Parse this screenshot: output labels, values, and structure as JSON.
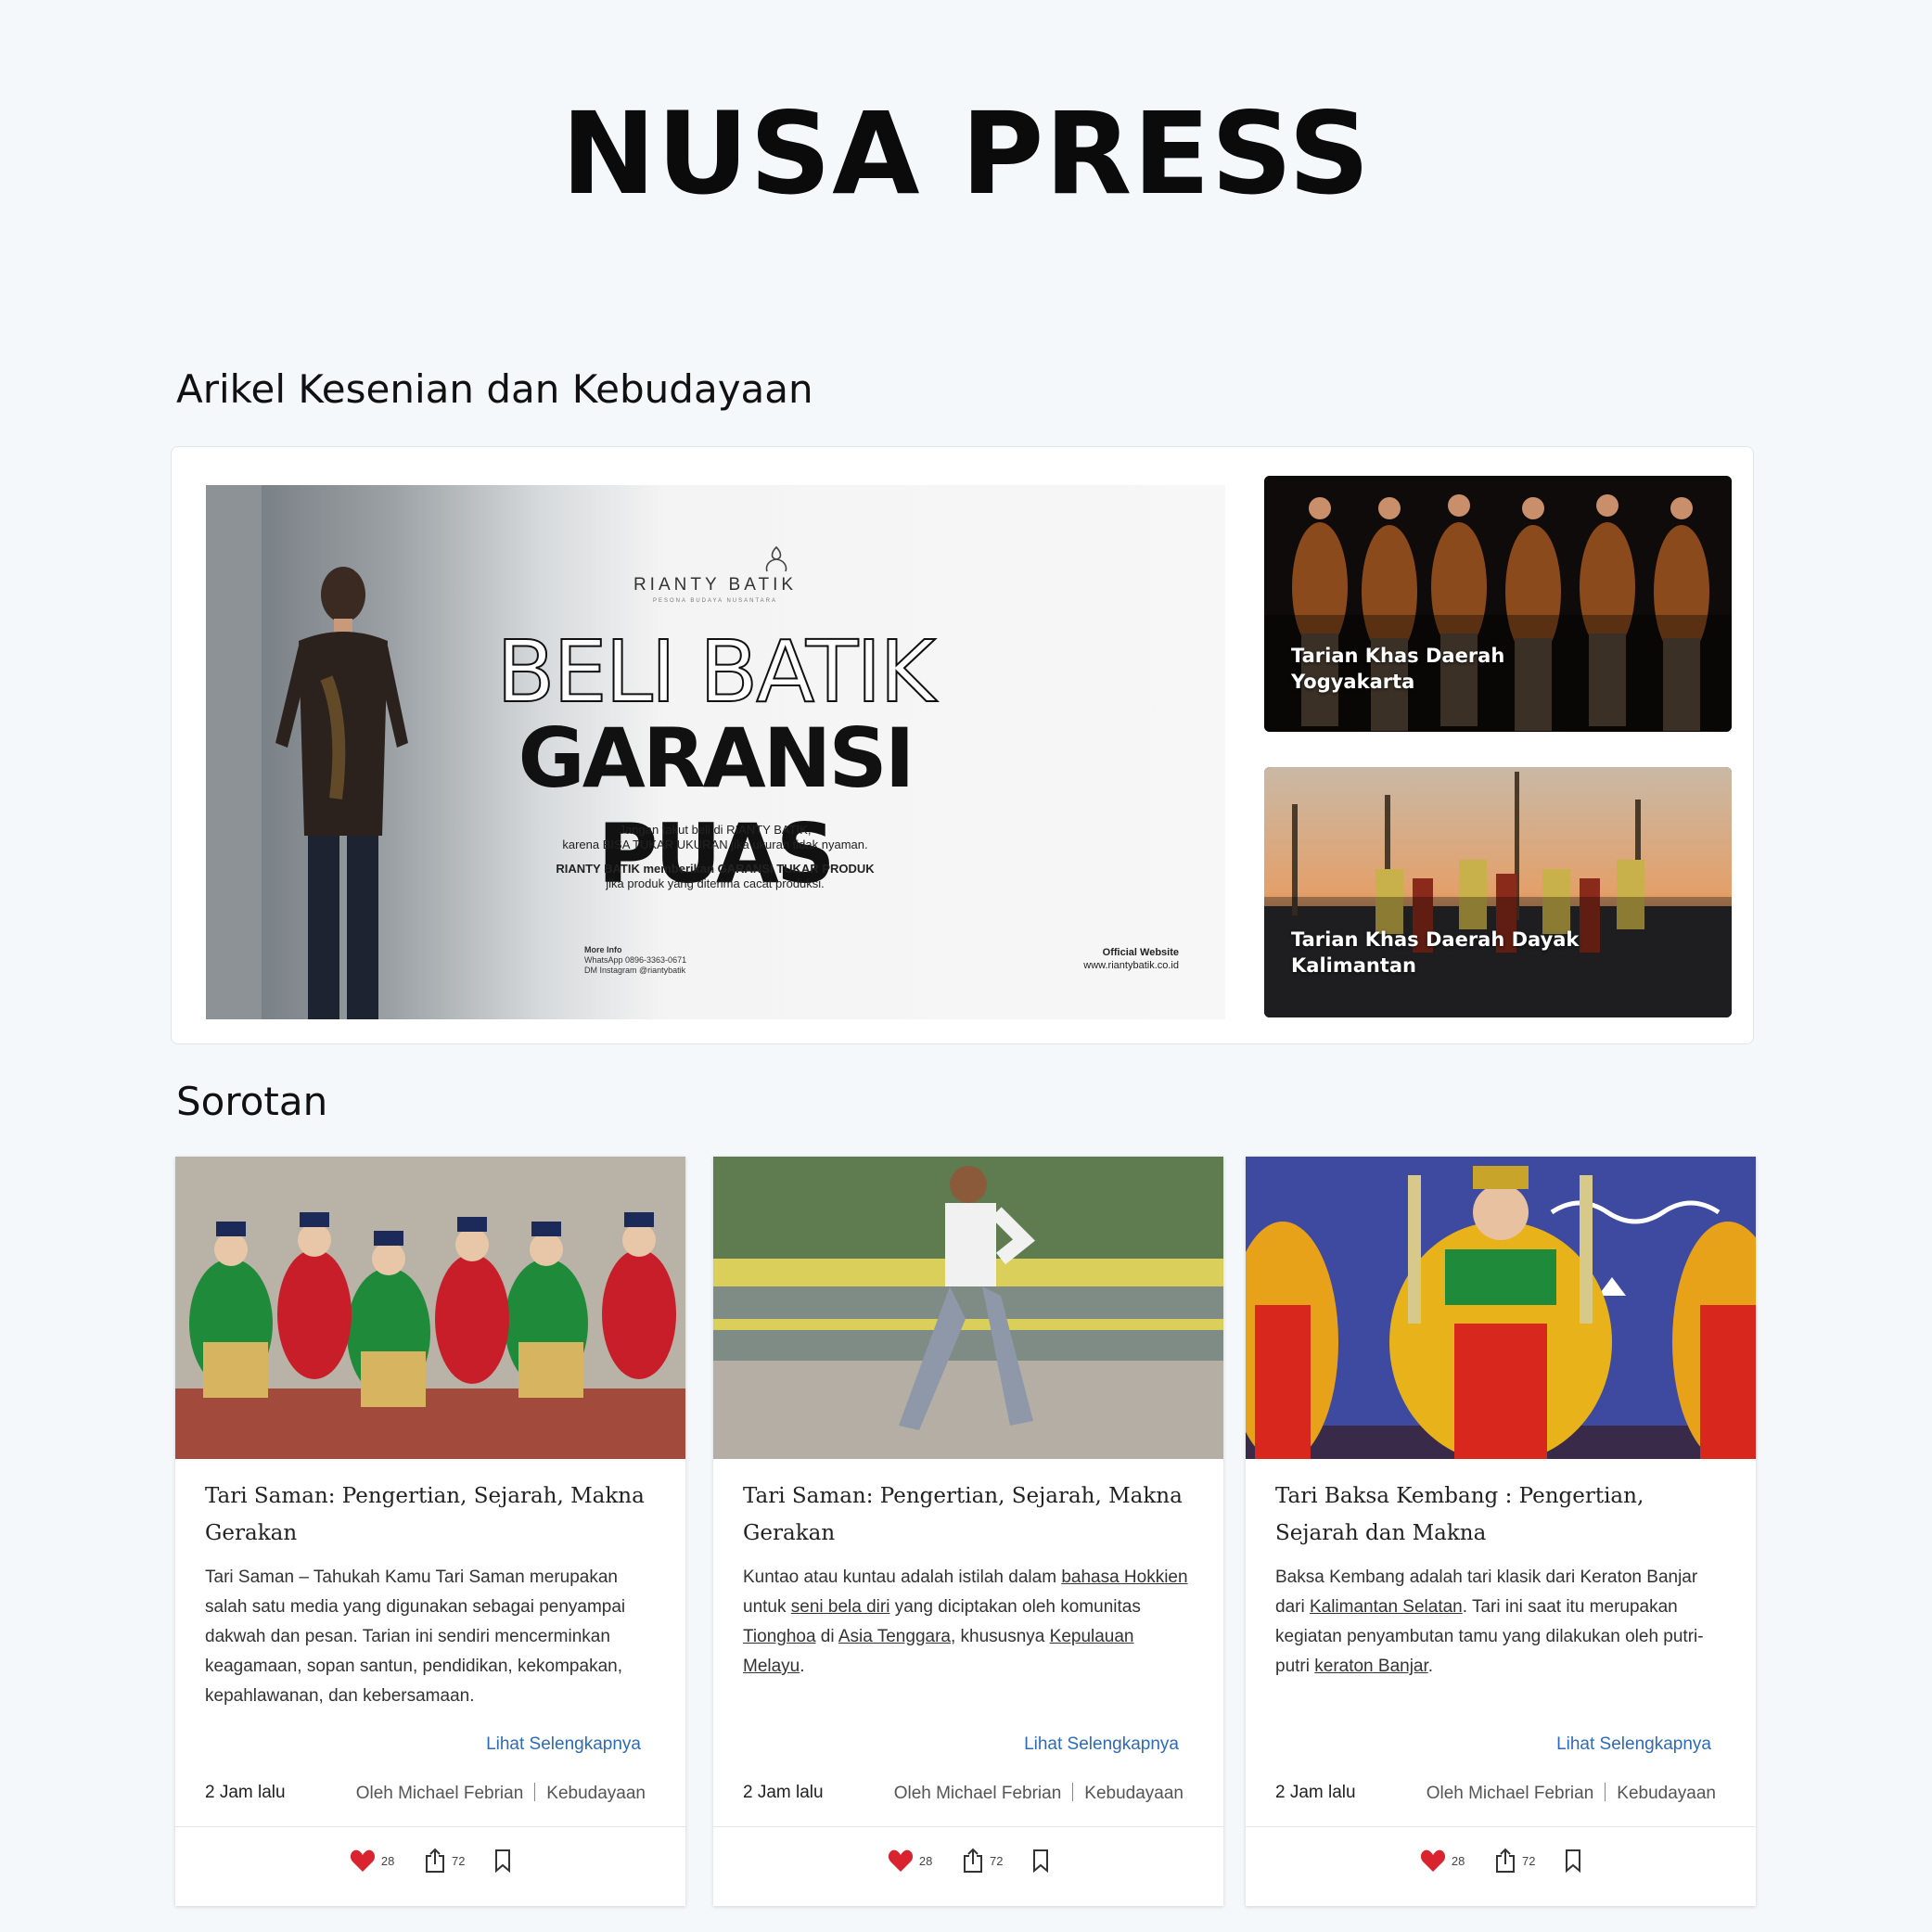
{
  "site": {
    "title": "NUSA PRESS"
  },
  "sections": {
    "featured_heading": "Arikel Kesenian dan Kebudayaan",
    "highlight_heading": "Sorotan"
  },
  "banner": {
    "brand": "RIANTY BATIK",
    "brand_sub": "PESONA BUDAYA NUSANTARA",
    "headline1": "BELI BATIK",
    "headline2": "GARANSI PUAS",
    "text1": "Jangan takut beli di RIANTY BATIK,",
    "text2": "karena BISA TUKAR UKURAN jika ukuran tidak nyaman.",
    "text3": "RIANTY BATIK memberikan GARANSI TUKAR PRODUK",
    "text4": "jika produk yang diterima cacat produksi.",
    "more_info_label": "More Info",
    "whatsapp": "WhatsApp 0896-3363-0671",
    "instagram": "DM Instagram @riantybatik",
    "official_label": "Official Website",
    "website": "www.riantybatik.co.id"
  },
  "side_articles": [
    {
      "line1": "Tarian Khas Daerah",
      "line2": "Yogyakarta"
    },
    {
      "line1": "Tarian Khas Daerah Dayak",
      "line2": "Kalimantan"
    }
  ],
  "cards": [
    {
      "title": "Tari Saman: Pengertian, Sejarah, Makna Gerakan",
      "excerpt": "Tari Saman – Tahukah Kamu Tari Saman merupakan salah satu media yang digunakan sebagai penyampai dakwah dan pesan. Tarian ini sendiri mencerminkan keagamaan, sopan santun, pendidikan, kekompakan, kepahlawanan, dan kebersamaan.",
      "more": "Lihat Selengkapnya",
      "time": "2 Jam lalu",
      "author": "Oleh Michael Febrian",
      "category": "Kebudayaan",
      "likes": "28",
      "shares": "72"
    },
    {
      "title": "Tari Saman: Pengertian, Sejarah, Makna Gerakan",
      "excerpt_parts": [
        "Kuntao atau kuntau adalah istilah dalam ",
        "bahasa Hokkien",
        " untuk ",
        "seni bela diri",
        " yang diciptakan oleh komunitas ",
        "Tionghoa",
        " di ",
        "Asia Tenggara",
        ", khususnya ",
        "Kepulauan Melayu",
        "."
      ],
      "more": "Lihat Selengkapnya",
      "time": "2 Jam lalu",
      "author": "Oleh Michael Febrian",
      "category": "Kebudayaan",
      "likes": "28",
      "shares": "72"
    },
    {
      "title": "Tari Baksa Kembang : Pengertian, Sejarah dan Makna",
      "excerpt_parts": [
        "Baksa Kembang adalah tari klasik dari Keraton Banjar dari ",
        "Kalimantan Selatan",
        ". Tari ini saat itu merupakan kegiatan penyambutan tamu yang dilakukan oleh putri-putri ",
        "keraton Banjar",
        "."
      ],
      "more": "Lihat Selengkapnya",
      "time": "2 Jam lalu",
      "author": "Oleh Michael Febrian",
      "category": "Kebudayaan",
      "likes": "28",
      "shares": "72"
    }
  ],
  "colors": {
    "accent_link": "#2f6bb4",
    "heart": "#d9232e",
    "page_bg": "#f5f8fb"
  },
  "icons": {
    "like": "heart-icon",
    "share": "share-icon",
    "save": "bookmark-icon"
  }
}
